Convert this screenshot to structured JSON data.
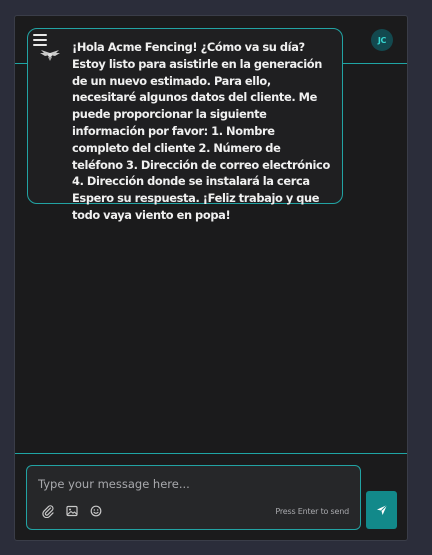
{
  "header": {
    "avatar_initials": "JC"
  },
  "message": {
    "text": "¡Hola Acme Fencing! ¿Cómo va su día? Estoy listo para asistirle en la generación de un nuevo estimado. Para ello, necesitaré algunos datos del cliente. Me puede proporcionar la siguiente información por favor: 1. Nombre completo del cliente 2. Número de teléfono 3. Dirección de correo electrónico 4. Dirección donde se instalará la cerca Espero su respuesta. ¡Feliz trabajo y que todo vaya viento en popa!"
  },
  "composer": {
    "placeholder": "Type your message here...",
    "hint": "Press Enter to send",
    "tools": [
      "paperclip-icon",
      "image-icon",
      "emoji-icon"
    ]
  },
  "colors": {
    "accent": "#1fa5a5",
    "send_button": "#12898a",
    "avatar_bg": "#13494f",
    "avatar_text": "#37d7d2"
  }
}
